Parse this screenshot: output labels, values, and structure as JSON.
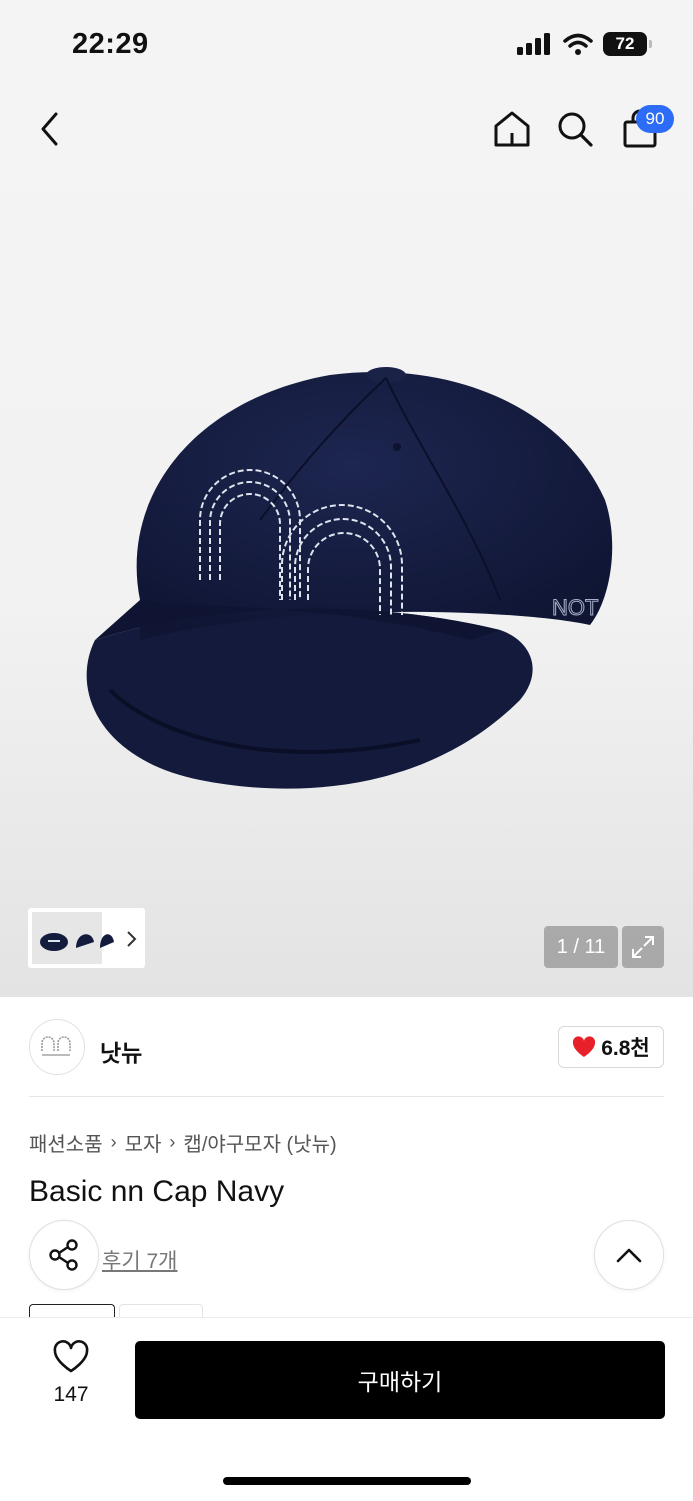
{
  "status_bar": {
    "time": "22:29",
    "battery": "72"
  },
  "nav": {
    "cart_count": "90"
  },
  "gallery": {
    "counter": "1 / 11"
  },
  "brand": {
    "name": "낫뉴",
    "likes": "6.8천",
    "heart_color": "#e8202a"
  },
  "breadcrumb": [
    "패션소품",
    "모자",
    "캡/야구모자 (낫뉴)"
  ],
  "product": {
    "title": "Basic nn Cap Navy",
    "reviews": "후기 7개"
  },
  "bottom_bar": {
    "wish_count": "147",
    "buy_label": "구매하기"
  },
  "colors": {
    "accent_blue": "#2d6cf6",
    "cap_navy": "#141c3d"
  }
}
